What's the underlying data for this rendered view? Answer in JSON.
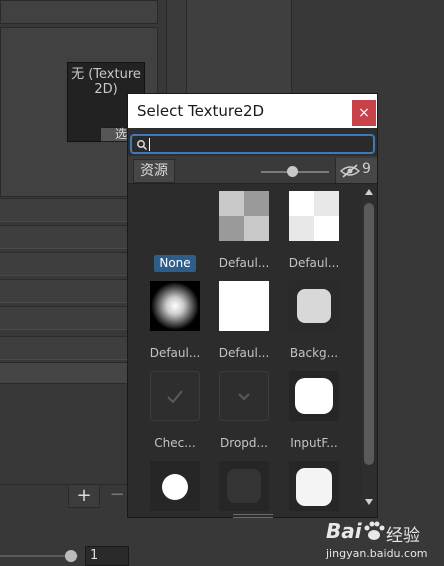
{
  "background": {
    "texture_field_label": "无 (Texture\n2D)",
    "select_button_label": "选",
    "plus_label": "+",
    "minus_label": "−",
    "number_field_value": "1"
  },
  "dialog": {
    "title": "Select Texture2D",
    "close_label": "×",
    "search_value": "",
    "tab_label": "资源",
    "slider_fraction": 0.45,
    "visibility_count": "9",
    "items": [
      {
        "label": "None",
        "kind": "none",
        "selected": true
      },
      {
        "label": "Defaul...",
        "kind": "checker-gray"
      },
      {
        "label": "Defaul...",
        "kind": "checker-white"
      },
      {
        "label": "Defaul...",
        "kind": "radial"
      },
      {
        "label": "Defaul...",
        "kind": "white"
      },
      {
        "label": "Backg...",
        "kind": "rounded-light"
      },
      {
        "label": "Chec...",
        "kind": "checkmark"
      },
      {
        "label": "Dropd...",
        "kind": "chevron"
      },
      {
        "label": "InputF...",
        "kind": "rounded-white"
      },
      {
        "label": "",
        "kind": "circle"
      },
      {
        "label": "",
        "kind": "rounded-dark"
      },
      {
        "label": "",
        "kind": "rounded-white2"
      }
    ]
  },
  "watermark": {
    "brand": "Bai",
    "brand2": "经验",
    "url": "jingyan.baidu.com"
  },
  "colors": {
    "accent": "#3d7ab8",
    "close": "#c8424a",
    "selection": "#2f5d8a"
  }
}
